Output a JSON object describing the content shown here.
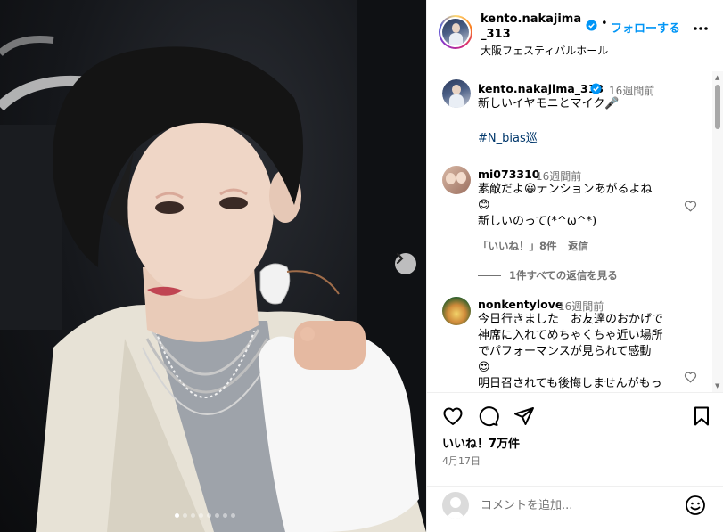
{
  "post": {
    "username": "kento.nakajima_313",
    "location": "大阪フェスティバルホール",
    "follow_label": "フォローする",
    "separator": "•"
  },
  "carousel": {
    "slide_count": 8,
    "current_slide": 1
  },
  "caption": {
    "username": "kento.nakajima_313",
    "time": "16週間前",
    "text": "新しいイヤモニとマイク🎤",
    "hashtag": "#N_bias巡"
  },
  "comments": [
    {
      "username": "mi073310",
      "time": "16週間前",
      "line1": "素敵だよ😀テンションあがるよね",
      "line2": "😊",
      "line3": "新しいのって(*^ω^*)",
      "likes_label": "「いいね！」8件",
      "reply_label": "返信",
      "view_replies": "1件すべての返信を見る"
    },
    {
      "username": "nonkentylove",
      "time": "16週間前",
      "line1": "今日行きました　お友達のおかげで",
      "line2": "神席に入れてめちゃくちゃ近い場所",
      "line3": "でパフォーマンスが見られて感動",
      "line4": "😍",
      "line5": "明日召されても後悔しませんがもっ"
    }
  ],
  "stats": {
    "likes": "いいね！7万件",
    "date": "4月17日"
  },
  "add_comment": {
    "placeholder": "コメントを追加..."
  },
  "colors": {
    "accent": "#0095f6",
    "verified": "#0095f6",
    "secondary_text": "#737373",
    "hashtag": "#00376b"
  }
}
